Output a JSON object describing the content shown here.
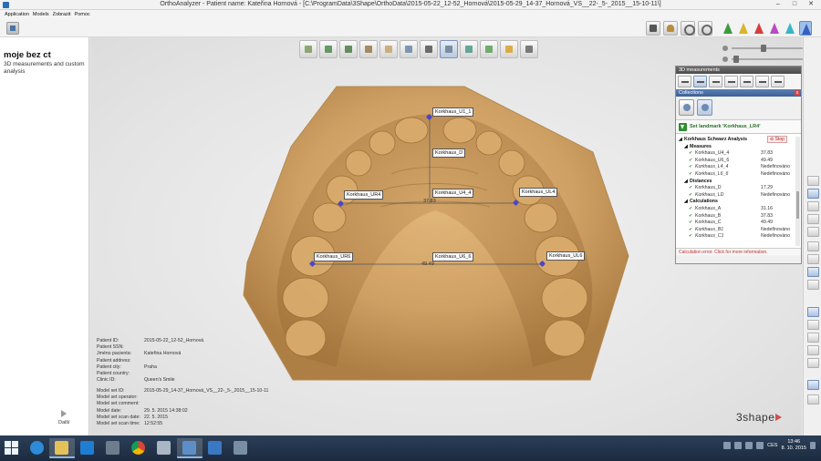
{
  "window": {
    "title": "OrthoAnalyzer - Patient name: Kateřina Hornová - [C:\\ProgramData\\3Shape\\OrthoData\\2015-05-22_12-52_Hornová\\2015-05-29_14-37_Hornová_VS__22-_5-_2015__15-10-11\\]",
    "min": "–",
    "max": "□",
    "close": "✕"
  },
  "menu": [
    "Application",
    "Models",
    "Zobrazit",
    "Pomoc"
  ],
  "left_panel": {
    "title": "moje bez ct",
    "subtitle": "3D measurements and custom analysis",
    "next_label": "Další"
  },
  "landmarks": [
    {
      "name": "Korkhaus_U1_1"
    },
    {
      "name": "Korkhaus_D"
    },
    {
      "name": "Korkhaus_UR4"
    },
    {
      "name": "Korkhaus_U4_4"
    },
    {
      "name": "Korkhaus_UL4"
    },
    {
      "name": "Korkhaus_UR6"
    },
    {
      "name": "Korkhaus_U6_6"
    },
    {
      "name": "Korkhaus_UL6"
    }
  ],
  "measure_values": {
    "u4_4": "37.83",
    "u6_6": "49.49"
  },
  "patient_info": [
    {
      "k": "Patient ID:",
      "v": "2015-05-22_12-52_Hornová"
    },
    {
      "k": "Patient SSN:",
      "v": ""
    },
    {
      "k": "Jméno pacienta:",
      "v": "Kateřina Hornová"
    },
    {
      "k": "Patient address:",
      "v": ""
    },
    {
      "k": "Patient city:",
      "v": "Praha"
    },
    {
      "k": "Patient country:",
      "v": ""
    },
    {
      "k": "Clinic ID:",
      "v": "Queen's Smile"
    }
  ],
  "model_info": [
    {
      "k": "Model set ID:",
      "v": "2015-05-29_14-37_Hornová_VS__22-_5-_2015__15-10-11"
    },
    {
      "k": "Model set operator:",
      "v": ""
    },
    {
      "k": "Model set comment:",
      "v": ""
    },
    {
      "k": "Model date:",
      "v": "29. 5. 2015 14:38:02"
    },
    {
      "k": "Model set scan date:",
      "v": "22. 5. 2015"
    },
    {
      "k": "Model set scan time:",
      "v": "12:52:55"
    }
  ],
  "logo": "3shape",
  "panel": {
    "header": "3D measurements",
    "collections_label": "Collections",
    "close": "x",
    "set_landmark": "Set landmark 'Korkhaus_LR4'",
    "analysis": "Korkhaus Schwarz Analysis",
    "stop_label": "Stop",
    "groups": {
      "measures": "Measures",
      "distances": "Distances",
      "calculations": "Calculations"
    },
    "measures": [
      {
        "name": "Korkhaus_U4_4",
        "value": "37.83",
        "italic": false
      },
      {
        "name": "Korkhaus_U6_6",
        "value": "49.49",
        "italic": false
      },
      {
        "name": "Korkhaus_L4_4",
        "value": "Nedefinováno",
        "italic": true
      },
      {
        "name": "Korkhaus_L6_6",
        "value": "Nedefinováno",
        "italic": true
      }
    ],
    "distances": [
      {
        "name": "Korkhaus_D",
        "value": "17.29",
        "italic": false
      },
      {
        "name": "Korkhaus_LD",
        "value": "Nedefinováno",
        "italic": true
      }
    ],
    "calculations": [
      {
        "name": "Korkhaus_A",
        "value": "31.16",
        "italic": false
      },
      {
        "name": "Korkhaus_B",
        "value": "37.83",
        "italic": false
      },
      {
        "name": "Korkhaus_C",
        "value": "49.49",
        "italic": false
      },
      {
        "name": "Korkhaus_B1",
        "value": "Nedefinováno",
        "italic": true
      },
      {
        "name": "Korkhaus_C1",
        "value": "Nedefinováno",
        "italic": true
      }
    ],
    "error": "Calculation error. Click for more information."
  },
  "tray": {
    "lang": "CES",
    "time": "13:46",
    "date": "8. 10. 2015"
  }
}
